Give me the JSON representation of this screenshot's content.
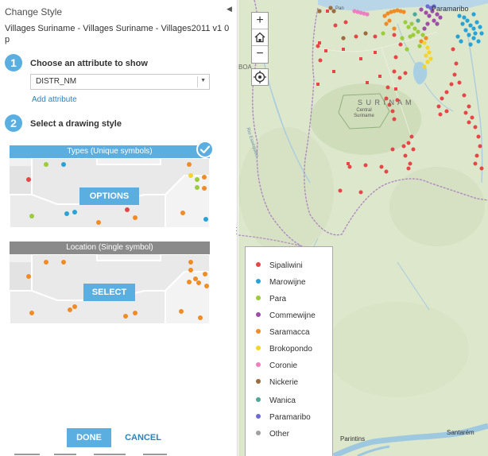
{
  "panel": {
    "title": "Change Style",
    "layer_name": "Villages Suriname - Villages Suriname - Villages2011 v1 0 p",
    "step1": {
      "number": "1",
      "label": "Choose an attribute to show"
    },
    "attribute_select": {
      "value": "DISTR_NM"
    },
    "add_attribute": "Add attribute",
    "step2": {
      "number": "2",
      "label": "Select a drawing style"
    },
    "style_types": {
      "title": "Types (Unique symbols)",
      "button": "OPTIONS",
      "selected": true
    },
    "style_location": {
      "title": "Location (Single symbol)",
      "button": "SELECT"
    },
    "done": "DONE",
    "cancel": "CANCEL"
  },
  "map": {
    "labels": {
      "country": "S U R I N A M",
      "paramaribo": "Paramaribo",
      "nature_reserve": "Central Suriname",
      "river": "Rio Essequibo",
      "parintins": "Parintins",
      "santarem": "Santarém",
      "boa": "BOA",
      "pan": "Pan"
    },
    "legend": [
      {
        "label": "Sipaliwini",
        "color": "#e64646"
      },
      {
        "label": "Marowijne",
        "color": "#29a3d6"
      },
      {
        "label": "Para",
        "color": "#9ccc3c"
      },
      {
        "label": "Commewijne",
        "color": "#9e4ea8"
      },
      {
        "label": "Saramacca",
        "color": "#f08c26"
      },
      {
        "label": "Brokopondo",
        "color": "#f5d52a"
      },
      {
        "label": "Coronie",
        "color": "#ee7fc0"
      },
      {
        "label": "Nickerie",
        "color": "#9c6b3e"
      },
      {
        "label": "Wanica",
        "color": "#4ea89a"
      },
      {
        "label": "Paramaribo",
        "color": "#6d6bd4"
      },
      {
        "label": "Other",
        "color": "#a0a0a0"
      }
    ]
  }
}
